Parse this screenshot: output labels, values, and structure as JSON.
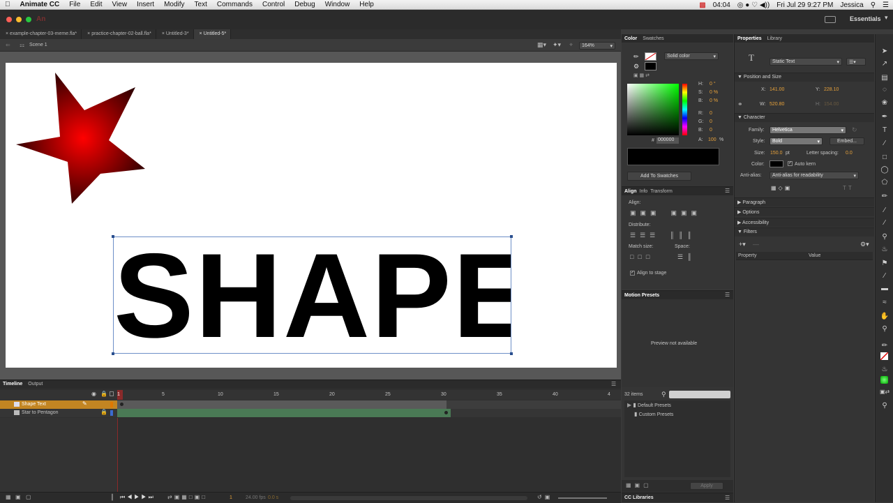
{
  "menubar": {
    "app_name": "Animate CC",
    "items": [
      "File",
      "Edit",
      "View",
      "Insert",
      "Modify",
      "Text",
      "Commands",
      "Control",
      "Debug",
      "Window",
      "Help"
    ],
    "battery_time": "04:04",
    "datetime": "Fri Jul 29  9:27 PM",
    "user": "Jessica"
  },
  "workspace": {
    "label": "Essentials"
  },
  "document_tabs": [
    {
      "label": "example-chapter-03-meme.fla*"
    },
    {
      "label": "practice-chapter-02-ball.fla*"
    },
    {
      "label": "Untitled-3*"
    },
    {
      "label": "Untitled-5*"
    }
  ],
  "scene": {
    "label": "Scene 1",
    "zoom": "164%"
  },
  "stage": {
    "text": "SHAPE",
    "star_color": "#cc0000"
  },
  "timeline": {
    "tabs": [
      "Timeline",
      "Output"
    ],
    "frame_numbers": [
      "1",
      "5",
      "10",
      "15",
      "20",
      "25",
      "30",
      "35",
      "40",
      "4"
    ],
    "layers": [
      {
        "name": "Shape Text",
        "selected": true
      },
      {
        "name": "Star to Pentagon",
        "selected": false
      }
    ],
    "current_frame": "1",
    "fps": "24.00 fps",
    "time": "0.0 s"
  },
  "color_panel": {
    "tabs": [
      "Color",
      "Swatches"
    ],
    "fill_type": "Solid color",
    "hsb": [
      {
        "k": "H:",
        "v": "0 °"
      },
      {
        "k": "S:",
        "v": "0 %"
      },
      {
        "k": "B:",
        "v": "0 %"
      }
    ],
    "rgb": [
      {
        "k": "R:",
        "v": "0"
      },
      {
        "k": "G:",
        "v": "0"
      },
      {
        "k": "B:",
        "v": "0"
      }
    ],
    "alpha_label": "A:",
    "alpha_value": "100",
    "alpha_unit": "%",
    "hex_label": "#",
    "hex": "000000",
    "add_to_swatches": "Add To Swatches"
  },
  "align_panel": {
    "tabs": [
      "Align",
      "Info",
      "Transform"
    ],
    "align_label": "Align:",
    "distribute_label": "Distribute:",
    "match_size_label": "Match size:",
    "space_label": "Space:",
    "align_to_stage": "Align to stage"
  },
  "motion_presets": {
    "title": "Motion Presets",
    "preview": "Preview not available",
    "count": "32 items",
    "folders": [
      "Default Presets",
      "Custom Presets"
    ],
    "apply": "Apply"
  },
  "cc_libraries": {
    "title": "CC Libraries"
  },
  "properties": {
    "tabs": [
      "Properties",
      "Library"
    ],
    "text_type": "Static Text",
    "position_section": "Position and Size",
    "x_label": "X:",
    "x": "141.00",
    "y_label": "Y:",
    "y": "228.10",
    "w_label": "W:",
    "w": "520.80",
    "h_label": "H:",
    "h": "154.00",
    "character_section": "Character",
    "family_label": "Family:",
    "family": "Helvetica",
    "style_label": "Style:",
    "style": "Bold",
    "embed": "Embed...",
    "size_label": "Size:",
    "size": "150.0",
    "size_unit": "pt",
    "spacing_label": "Letter spacing:",
    "spacing": "0.0",
    "color_label": "Color:",
    "auto_kern": "Auto kern",
    "antialias_label": "Anti-alias:",
    "antialias": "Anti-alias for readability",
    "collapsed_sections": [
      "Paragraph",
      "Options",
      "Accessibility"
    ],
    "filters_section": "Filters",
    "filter_columns": [
      "Property",
      "Value"
    ]
  }
}
